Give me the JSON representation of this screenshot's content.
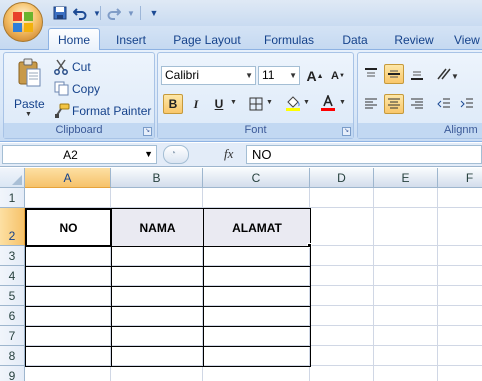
{
  "ribbon_tabs": [
    "Home",
    "Insert",
    "Page Layout",
    "Formulas",
    "Data",
    "Review",
    "View"
  ],
  "clipboard": {
    "paste": "Paste",
    "cut": "Cut",
    "copy": "Copy",
    "format_painter": "Format Painter",
    "label": "Clipboard"
  },
  "font": {
    "name": "Calibri",
    "size": "11",
    "bold": "B",
    "italic": "I",
    "underline": "U",
    "grow": "A",
    "shrink": "A",
    "label": "Font"
  },
  "alignment": {
    "label": "Alignm"
  },
  "formula_bar": {
    "name_box": "A2",
    "fx": "fx",
    "value": "NO"
  },
  "grid": {
    "columns": [
      "A",
      "B",
      "C",
      "D",
      "E",
      "F"
    ],
    "rows": [
      "1",
      "2",
      "3",
      "4",
      "5",
      "6",
      "7",
      "8",
      "9"
    ],
    "table_headers": [
      "NO",
      "NAMA",
      "ALAMAT"
    ],
    "active_cell": "A2"
  },
  "colors": {
    "font_color_bar": "#ff0000",
    "fill_color_bar": "#ffff00",
    "selected_header": "#f6c26a"
  }
}
